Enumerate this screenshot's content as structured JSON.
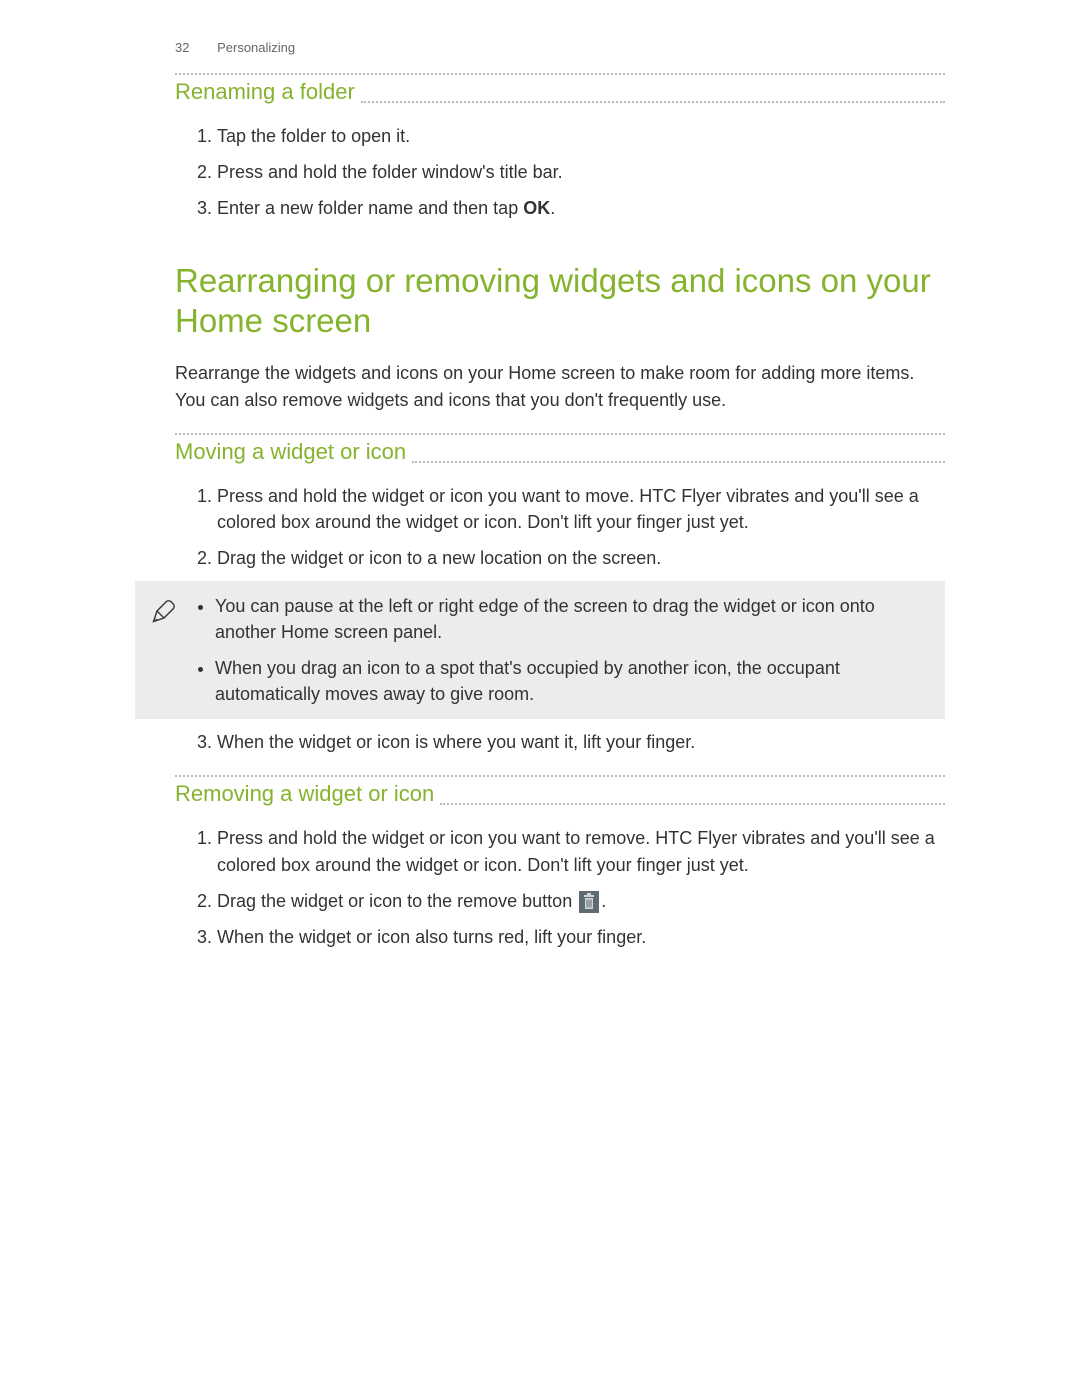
{
  "header": {
    "page_number": "32",
    "section": "Personalizing"
  },
  "renaming": {
    "title": "Renaming a folder",
    "steps": [
      "Tap the folder to open it.",
      "Press and hold the folder window's title bar.",
      "Enter a new folder name and then tap "
    ],
    "step3_bold": "OK",
    "step3_suffix": "."
  },
  "rearranging": {
    "title": "Rearranging or removing widgets and icons on your Home screen",
    "intro": "Rearrange the widgets and icons on your Home screen to make room for adding more items. You can also remove widgets and icons that you don't frequently use."
  },
  "moving": {
    "title": "Moving a widget or icon",
    "step1": "Press and hold the widget or icon you want to move. HTC Flyer vibrates and you'll see a colored box around the widget or icon. Don't lift your finger just yet.",
    "step2": "Drag the widget or icon to a new location on the screen.",
    "note1": "You can pause at the left or right edge of the screen to drag the widget or icon onto another Home screen panel.",
    "note2": "When you drag an icon to a spot that's occupied by another icon, the occupant automatically moves away to give room.",
    "step3": "When the widget or icon is where you want it, lift your finger."
  },
  "removing": {
    "title": "Removing a widget or icon",
    "step1": "Press and hold the widget or icon you want to remove. HTC Flyer vibrates and you'll see a colored box around the widget or icon. Don't lift your finger just yet.",
    "step2_pre": "Drag the widget or icon to the remove button ",
    "step2_post": ".",
    "step3": "When the widget or icon also turns red, lift your finger."
  }
}
